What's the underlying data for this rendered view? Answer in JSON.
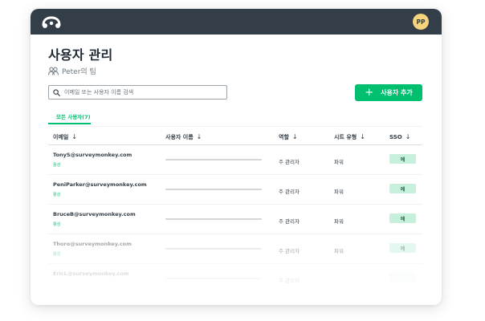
{
  "topbar": {
    "avatar_initials": "PP"
  },
  "page": {
    "title": "사용자 관리",
    "team": "Peter의 팀"
  },
  "search": {
    "placeholder": "이메일 또는 사용자 이름 검색"
  },
  "add_button": {
    "label": "사용자 추가"
  },
  "tabs": [
    {
      "label": "모든 사용자(7)",
      "active": true
    }
  ],
  "table": {
    "columns": [
      {
        "label": "이메일"
      },
      {
        "label": "사용자 이름"
      },
      {
        "label": "역할"
      },
      {
        "label": "시트 유형"
      },
      {
        "label": "SSO"
      }
    ],
    "rows": [
      {
        "email": "TonyS@surveymonkey.com",
        "status": "활성",
        "role": "주 관리자",
        "seat": "파워",
        "sso": "예"
      },
      {
        "email": "PeniParker@surveymonkey.com",
        "status": "활성",
        "role": "주 관리자",
        "seat": "파워",
        "sso": "예"
      },
      {
        "email": "BruceB@surveymonkey.com",
        "status": "활성",
        "role": "주 관리자",
        "seat": "파워",
        "sso": "예"
      },
      {
        "email": "Thoro@surveymonkey.com",
        "status": "활성",
        "role": "주 관리자",
        "seat": "파워",
        "sso": "예"
      },
      {
        "email": "EricL@surveymonkey.com",
        "status": "",
        "role": "주 관리자",
        "seat": "",
        "sso": ""
      }
    ]
  },
  "colors": {
    "brand": "#00bf6f",
    "topbar": "#333e48",
    "avatar": "#f4d57b",
    "sso_badge": "#c7f0dc"
  },
  "icons": {
    "logo": "surveymonkey-logo-icon",
    "team": "team-icon",
    "search": "search-icon",
    "sort": "arrow-down-icon",
    "add": "plus-icon"
  }
}
